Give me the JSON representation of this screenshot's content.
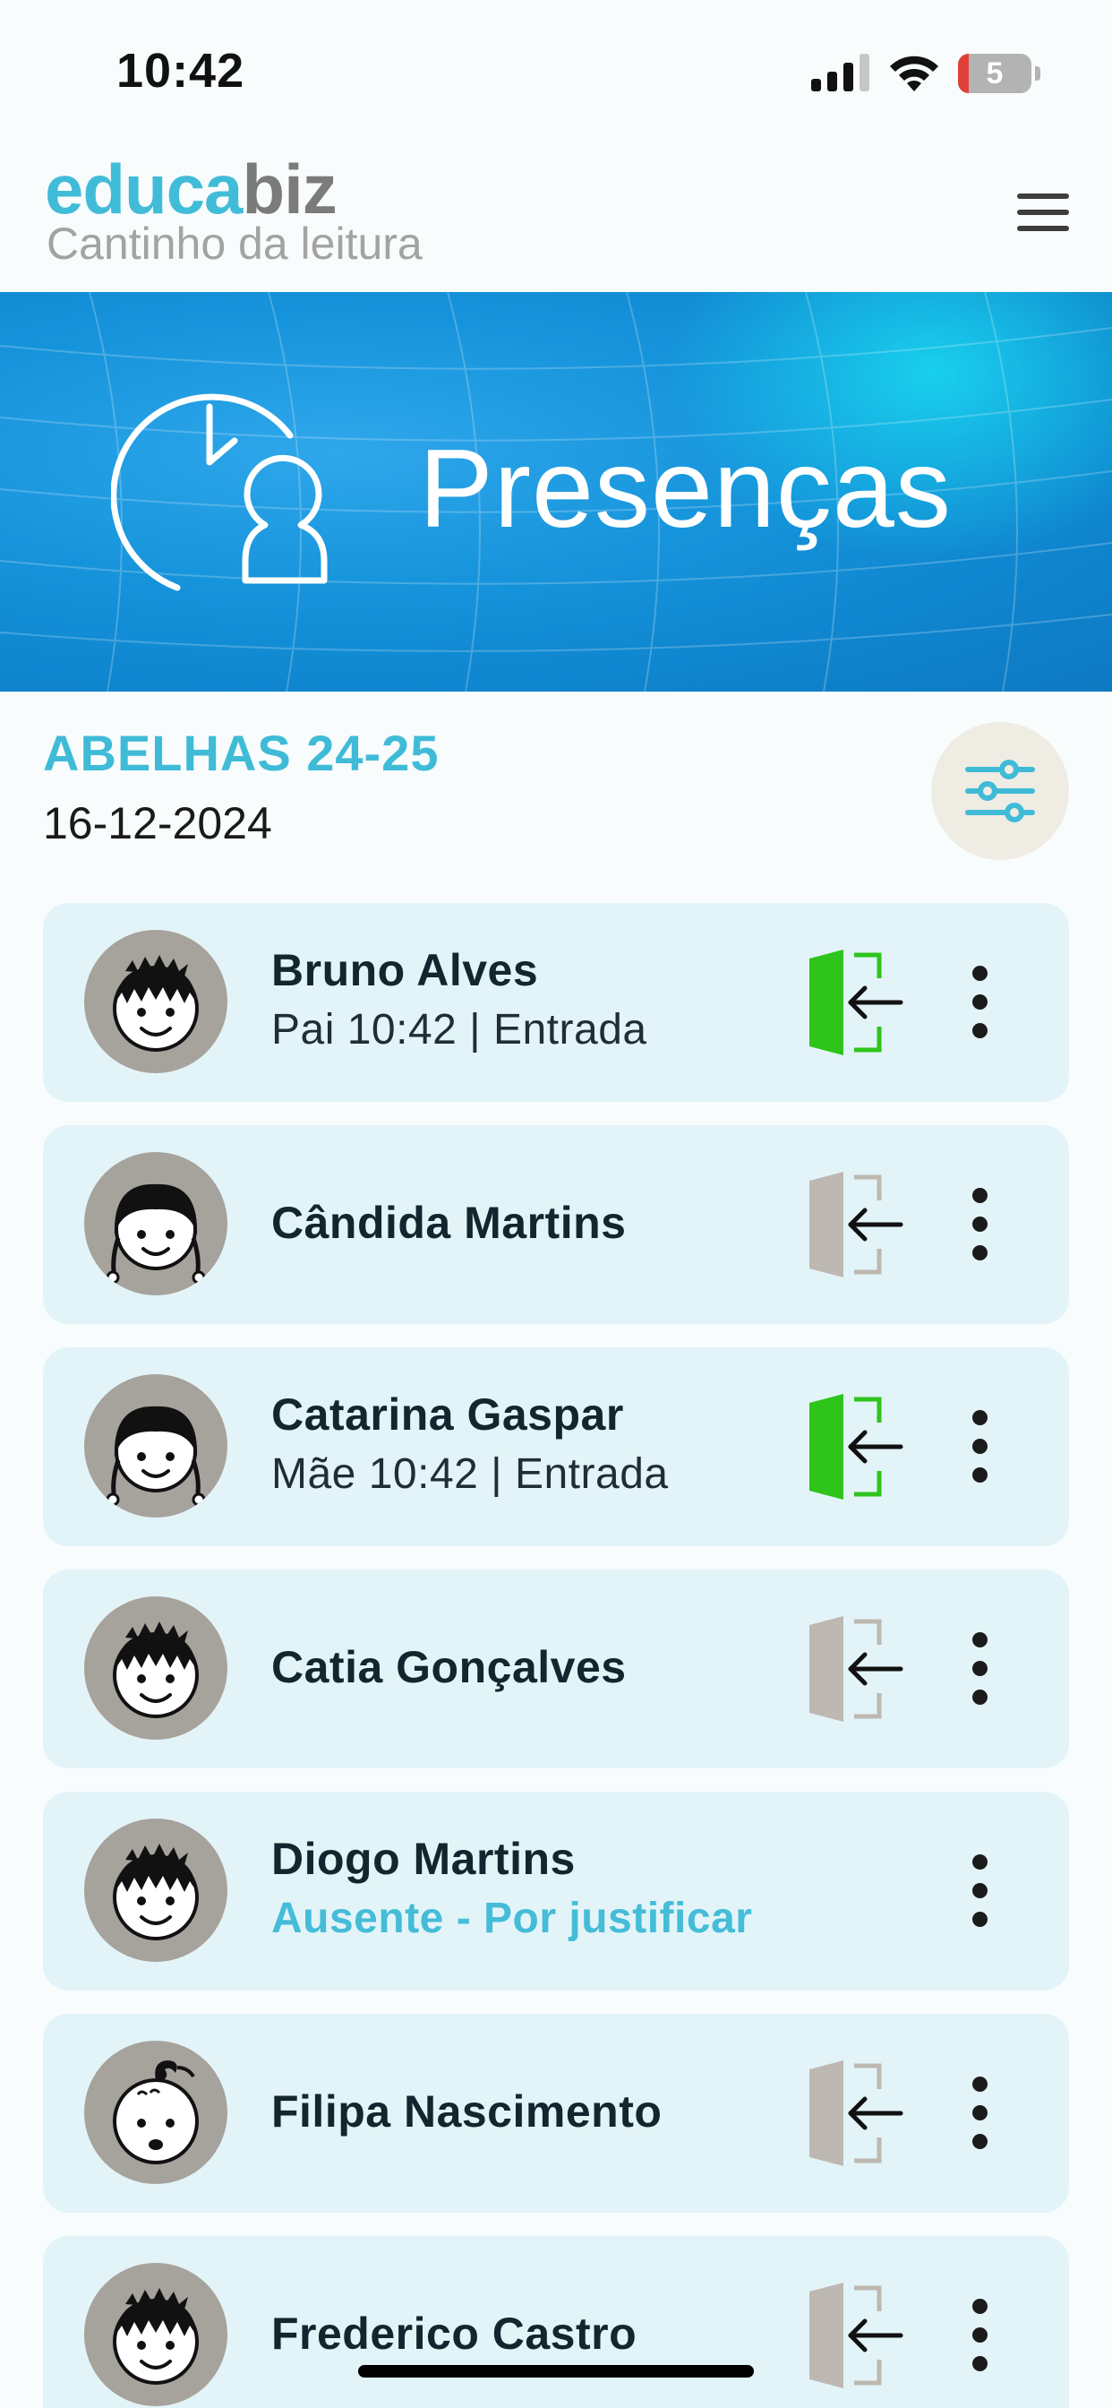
{
  "status_bar": {
    "time": "10:42",
    "battery_level": "5"
  },
  "header": {
    "logo_part1": "educa",
    "logo_part2": "biz",
    "subtitle": "Cantinho da leitura"
  },
  "banner": {
    "title": "Presenças"
  },
  "group": {
    "class_name": "ABELHAS 24-25",
    "date": "16-12-2024"
  },
  "colors": {
    "brand_teal": "#41bcd8",
    "card_bg": "#e3f4f8",
    "present_green": "#2ec41c",
    "door_grey": "#bdb8b1"
  },
  "students": [
    {
      "name": "Bruno Alves",
      "info": "Pai 10:42 | Entrada",
      "status": "present",
      "avatar": "boy"
    },
    {
      "name": "Cândida Martins",
      "info": "",
      "status": "none",
      "avatar": "girl"
    },
    {
      "name": "Catarina Gaspar",
      "info": "Mãe 10:42 | Entrada",
      "status": "present",
      "avatar": "girl"
    },
    {
      "name": "Catia Gonçalves",
      "info": "",
      "status": "none",
      "avatar": "boy"
    },
    {
      "name": "Diogo Martins",
      "info": "Ausente - Por justificar",
      "status": "absent",
      "avatar": "boy"
    },
    {
      "name": "Filipa Nascimento",
      "info": "",
      "status": "none",
      "avatar": "baby"
    },
    {
      "name": "Frederico Castro",
      "info": "",
      "status": "none",
      "avatar": "boy"
    }
  ]
}
